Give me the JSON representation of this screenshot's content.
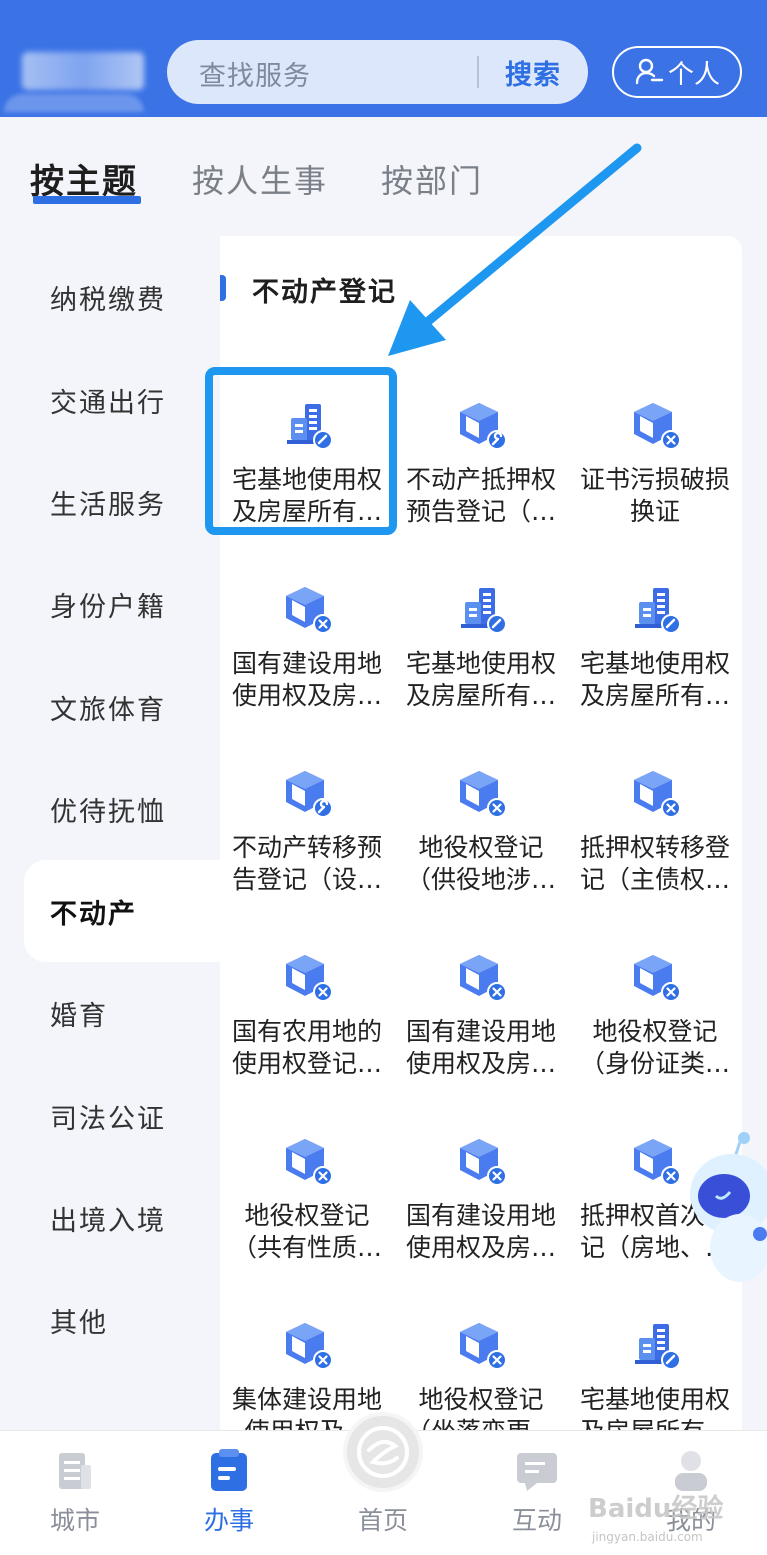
{
  "header": {
    "search_placeholder": "查找服务",
    "search_button": "搜索",
    "personal_button": "个人"
  },
  "tabs": [
    {
      "label": "按主题",
      "active": true
    },
    {
      "label": "按人生事",
      "active": false
    },
    {
      "label": "按部门",
      "active": false
    }
  ],
  "categories": [
    {
      "label": "纳税缴费"
    },
    {
      "label": "交通出行"
    },
    {
      "label": "生活服务"
    },
    {
      "label": "身份户籍"
    },
    {
      "label": "文旅体育"
    },
    {
      "label": "优待抚恤"
    },
    {
      "label": "不动产",
      "active": true
    },
    {
      "label": "婚育"
    },
    {
      "label": "司法公证"
    },
    {
      "label": "出境入境"
    },
    {
      "label": "其他"
    }
  ],
  "panel": {
    "title": "不动产登记",
    "services": [
      {
        "label": "宅基地使用权\n及房屋所有…",
        "icon": "building-icon"
      },
      {
        "label": "不动产抵押权\n预告登记（…",
        "icon": "cube-wrench-icon"
      },
      {
        "label": "证书污损破损\n换证",
        "icon": "cube-x-icon"
      },
      {
        "label": "国有建设用地\n使用权及房…",
        "icon": "cube-x-icon"
      },
      {
        "label": "宅基地使用权\n及房屋所有…",
        "icon": "building-icon"
      },
      {
        "label": "宅基地使用权\n及房屋所有…",
        "icon": "building-icon"
      },
      {
        "label": "不动产转移预\n告登记（设…",
        "icon": "cube-wrench-icon"
      },
      {
        "label": "地役权登记\n（供役地涉…",
        "icon": "cube-x-icon"
      },
      {
        "label": "抵押权转移登\n记（主债权…",
        "icon": "cube-x-icon"
      },
      {
        "label": "国有农用地的\n使用权登记…",
        "icon": "cube-x-icon"
      },
      {
        "label": "国有建设用地\n使用权及房…",
        "icon": "cube-x-icon"
      },
      {
        "label": "地役权登记\n（身份证类…",
        "icon": "cube-x-icon"
      },
      {
        "label": "地役权登记\n（共有性质…",
        "icon": "cube-x-icon"
      },
      {
        "label": "国有建设用地\n使用权及房…",
        "icon": "cube-x-icon"
      },
      {
        "label": "抵押权首次登\n记（房地、…",
        "icon": "cube-x-icon"
      },
      {
        "label": "集体建设用地\n使用权及…",
        "icon": "cube-x-icon"
      },
      {
        "label": "地役权登记\n（坐落变更…",
        "icon": "cube-x-icon"
      },
      {
        "label": "宅基地使用权\n及房屋所有…",
        "icon": "building-icon"
      }
    ]
  },
  "bottom_nav": [
    {
      "label": "城市",
      "icon": "city-icon"
    },
    {
      "label": "办事",
      "icon": "task-icon",
      "active": true
    },
    {
      "label": "首页",
      "icon": "home-logo-icon"
    },
    {
      "label": "互动",
      "icon": "chat-icon"
    },
    {
      "label": "我的",
      "icon": "profile-icon"
    }
  ],
  "watermark": "Baidu经验",
  "watermark_sub": "jingyan.baidu.com",
  "colors": {
    "primary": "#3b73e6",
    "accent": "#2f6fe4",
    "highlight": "#1e97f0"
  }
}
